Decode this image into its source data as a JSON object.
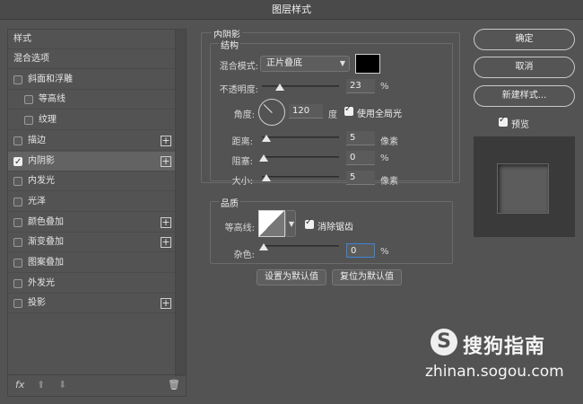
{
  "window": {
    "title": "图层样式"
  },
  "sidebar": {
    "header": "样式",
    "items": [
      {
        "label": "混合选项",
        "checkbox": null,
        "plus": false,
        "selected": false,
        "indent": 0
      },
      {
        "label": "斜面和浮雕",
        "checkbox": false,
        "plus": false,
        "selected": false,
        "indent": 0
      },
      {
        "label": "等高线",
        "checkbox": false,
        "plus": false,
        "selected": false,
        "indent": 1
      },
      {
        "label": "纹理",
        "checkbox": false,
        "plus": false,
        "selected": false,
        "indent": 1
      },
      {
        "label": "描边",
        "checkbox": false,
        "plus": true,
        "selected": false,
        "indent": 0
      },
      {
        "label": "内阴影",
        "checkbox": true,
        "plus": true,
        "selected": true,
        "indent": 0
      },
      {
        "label": "内发光",
        "checkbox": false,
        "plus": false,
        "selected": false,
        "indent": 0
      },
      {
        "label": "光泽",
        "checkbox": false,
        "plus": false,
        "selected": false,
        "indent": 0
      },
      {
        "label": "颜色叠加",
        "checkbox": false,
        "plus": true,
        "selected": false,
        "indent": 0
      },
      {
        "label": "渐变叠加",
        "checkbox": false,
        "plus": true,
        "selected": false,
        "indent": 0
      },
      {
        "label": "图案叠加",
        "checkbox": false,
        "plus": false,
        "selected": false,
        "indent": 0
      },
      {
        "label": "外发光",
        "checkbox": false,
        "plus": false,
        "selected": false,
        "indent": 0
      },
      {
        "label": "投影",
        "checkbox": false,
        "plus": true,
        "selected": false,
        "indent": 0
      }
    ],
    "footer": {
      "fx": "fx",
      "up": "⬆",
      "down": "⬇",
      "trash": "🗑"
    }
  },
  "inner_shadow": {
    "title": "内阴影",
    "structure": {
      "title": "结构",
      "blend_mode_label": "混合模式:",
      "blend_mode_value": "正片叠底",
      "color": "#000000",
      "opacity_label": "不透明度:",
      "opacity_value": "23",
      "opacity_unit": "%",
      "opacity_level": 0.23,
      "angle_label": "角度:",
      "angle_value": "120",
      "angle_unit": "度",
      "global_light_label": "使用全局光",
      "distance_label": "距离:",
      "distance_value": "5",
      "distance_unit": "像素",
      "choke_label": "阻塞:",
      "choke_value": "0",
      "choke_unit": "%",
      "size_label": "大小:",
      "size_value": "5",
      "size_unit": "像素"
    },
    "quality": {
      "title": "品质",
      "contour_label": "等高线:",
      "antialias_label": "消除锯齿",
      "noise_label": "杂色:",
      "noise_value": "0",
      "noise_unit": "%"
    },
    "buttons": {
      "set_default": "设置为默认值",
      "reset_default": "复位为默认值"
    }
  },
  "actions": {
    "ok": "确定",
    "cancel": "取消",
    "new_style": "新建样式...",
    "preview_label": "预览"
  },
  "watermark": {
    "logo": "S",
    "text": "搜狗指南",
    "url": "zhinan.sogou.com"
  }
}
